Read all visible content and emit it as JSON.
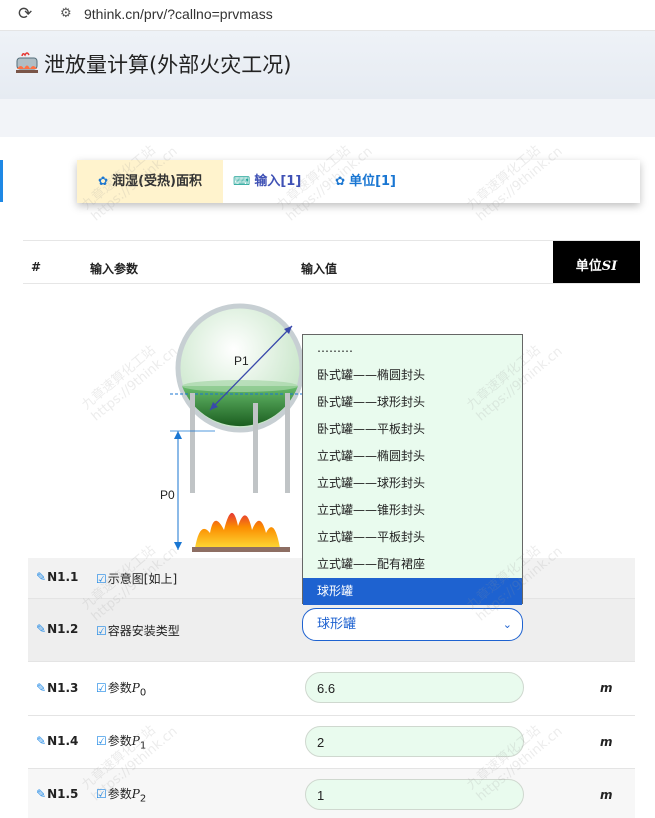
{
  "browser": {
    "url": "9think.cn/prv/?callno=prvmass"
  },
  "page": {
    "title": "泄放量计算(外部火灾工况)"
  },
  "tabs": [
    {
      "label": "润湿(受热)面积",
      "icon": "gear-icon"
    },
    {
      "label": "输入[1]",
      "icon": "keyboard-icon"
    },
    {
      "label": "单位[1]",
      "icon": "gear-icon"
    }
  ],
  "table": {
    "headers": {
      "num": "#",
      "param": "输入参数",
      "value": "输入值",
      "unit_prefix": "单位",
      "unit_system": "SI"
    }
  },
  "diagram": {
    "p1_label": "P1",
    "p0_label": "P0"
  },
  "dropdown": {
    "options": [
      "………",
      "卧式罐——椭圆封头",
      "卧式罐——球形封头",
      "卧式罐——平板封头",
      "立式罐——椭圆封头",
      "立式罐——球形封头",
      "立式罐——锥形封头",
      "立式罐——平板封头",
      "立式罐——配有裙座",
      "球形罐"
    ],
    "selected": "球形罐"
  },
  "rows": [
    {
      "code": "N1.1",
      "label": "示意图[如上]"
    },
    {
      "code": "N1.2",
      "label": "容器安装类型",
      "value": "球形罐"
    },
    {
      "code": "N1.3",
      "label": "参数",
      "var": "P",
      "sub": "0",
      "value": "6.6",
      "unit": "m"
    },
    {
      "code": "N1.4",
      "label": "参数",
      "var": "P",
      "sub": "1",
      "value": "2",
      "unit": "m"
    },
    {
      "code": "N1.5",
      "label": "参数",
      "var": "P",
      "sub": "2",
      "value": "1",
      "unit": "m"
    }
  ],
  "watermark": {
    "cn": "九章速算化工站",
    "url": "https://9think.cn"
  },
  "colors": {
    "accent": "#1e62d0",
    "input_bg": "#e9fbee",
    "tab_active_bg": "#fff3cd"
  }
}
